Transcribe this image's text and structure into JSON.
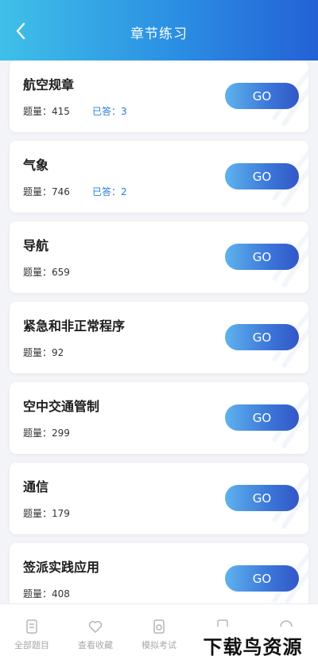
{
  "header": {
    "title": "章节练习"
  },
  "chapters": [
    {
      "title": "航空规章",
      "count_label": "题量：",
      "count": "415",
      "answered_label": "已答：",
      "answered": "3",
      "go_label": "GO"
    },
    {
      "title": "气象",
      "count_label": "题量：",
      "count": "746",
      "answered_label": "已答：",
      "answered": "2",
      "go_label": "GO"
    },
    {
      "title": "导航",
      "count_label": "题量：",
      "count": "659",
      "go_label": "GO"
    },
    {
      "title": "紧急和非正常程序",
      "count_label": "题量：",
      "count": "92",
      "go_label": "GO"
    },
    {
      "title": "空中交通管制",
      "count_label": "题量：",
      "count": "299",
      "go_label": "GO"
    },
    {
      "title": "通信",
      "count_label": "题量：",
      "count": "179",
      "go_label": "GO"
    },
    {
      "title": "签派实践应用",
      "count_label": "题量：",
      "count": "408",
      "go_label": "GO"
    }
  ],
  "bottom_nav": {
    "items": [
      {
        "label": "全部题目",
        "icon": "document-icon"
      },
      {
        "label": "查看收藏",
        "icon": "heart-icon"
      },
      {
        "label": "模拟考试",
        "icon": "exam-icon"
      },
      {
        "label": "",
        "icon": "notes-icon"
      },
      {
        "label": "",
        "icon": "user-icon"
      }
    ]
  },
  "watermark": "下载鸟资源",
  "colors": {
    "header_start": "#3fc0e8",
    "header_end": "#2461d6",
    "button_start": "#5fb2ee",
    "button_end": "#3356c8",
    "answered_text": "#2a7bd1"
  }
}
